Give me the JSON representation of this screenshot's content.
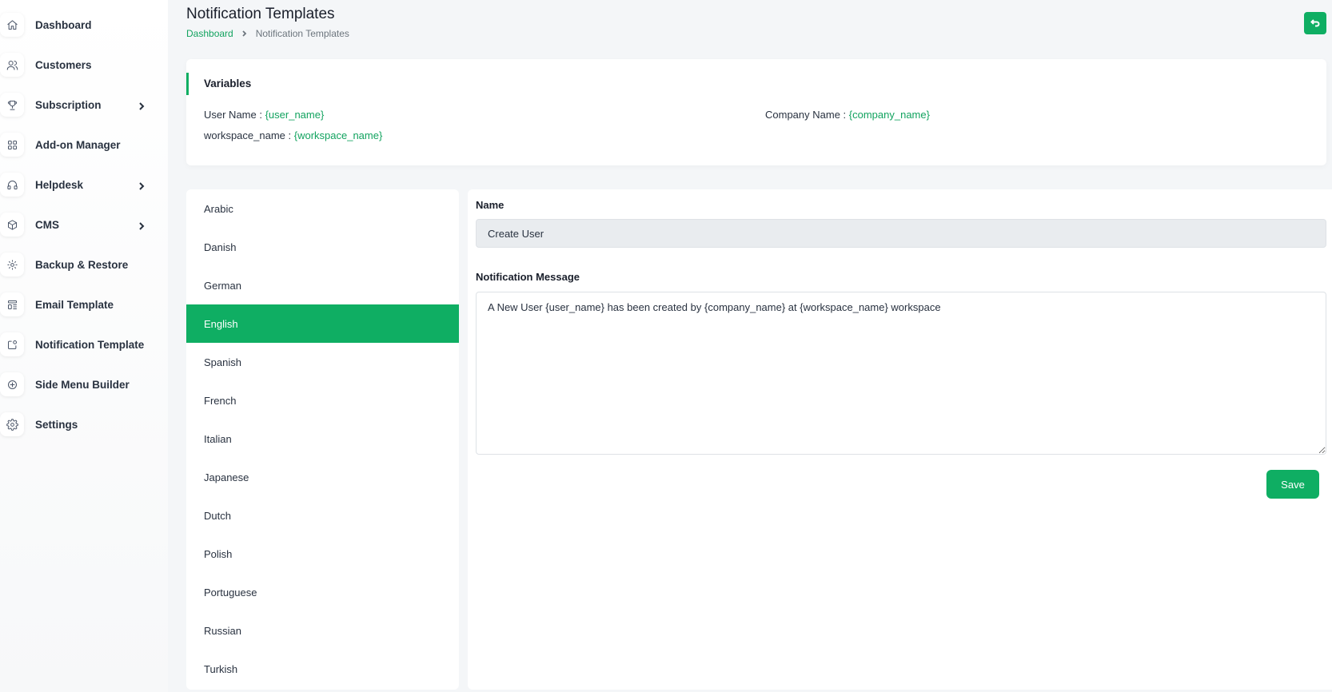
{
  "sidebar": {
    "items": [
      {
        "label": "Dashboard",
        "icon": "home-icon",
        "has_submenu": false
      },
      {
        "label": "Customers",
        "icon": "users-icon",
        "has_submenu": false
      },
      {
        "label": "Subscription",
        "icon": "trophy-icon",
        "has_submenu": true
      },
      {
        "label": "Add-on Manager",
        "icon": "apps-icon",
        "has_submenu": false
      },
      {
        "label": "Helpdesk",
        "icon": "headphones-icon",
        "has_submenu": true
      },
      {
        "label": "CMS",
        "icon": "package-icon",
        "has_submenu": true
      },
      {
        "label": "Backup & Restore",
        "icon": "backup-icon",
        "has_submenu": false
      },
      {
        "label": "Email Template",
        "icon": "template-icon",
        "has_submenu": false
      },
      {
        "label": "Notification Template",
        "icon": "notification-icon",
        "has_submenu": false
      },
      {
        "label": "Side Menu Builder",
        "icon": "circle-plus-icon",
        "has_submenu": false
      },
      {
        "label": "Settings",
        "icon": "gear-icon",
        "has_submenu": false
      }
    ]
  },
  "header": {
    "title": "Notification Templates",
    "breadcrumb": {
      "home": "Dashboard",
      "current": "Notification Templates"
    },
    "back_icon": "back-arrow-icon"
  },
  "variables": {
    "title": "Variables",
    "items": [
      {
        "label": "User Name : ",
        "value": "{user_name}"
      },
      {
        "label": "Company Name : ",
        "value": "{company_name}"
      },
      {
        "label": "workspace_name : ",
        "value": "{workspace_name}"
      }
    ]
  },
  "languages": {
    "selected": "English",
    "items": [
      "Arabic",
      "Danish",
      "German",
      "English",
      "Spanish",
      "French",
      "Italian",
      "Japanese",
      "Dutch",
      "Polish",
      "Portuguese",
      "Russian",
      "Turkish"
    ]
  },
  "form": {
    "name_label": "Name",
    "name_value": "Create User",
    "message_label": "Notification Message",
    "message_value": "A New User {user_name} has been created by {company_name} at {workspace_name} workspace",
    "save_label": "Save"
  },
  "colors": {
    "primary": "#0fae63",
    "link": "#12a35f"
  }
}
